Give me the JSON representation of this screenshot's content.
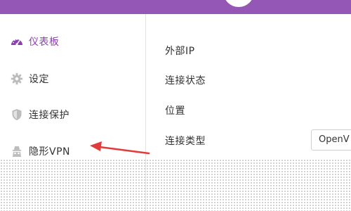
{
  "sidebar": {
    "items": [
      {
        "label": "仪表板",
        "icon": "dashboard-icon",
        "active": true
      },
      {
        "label": "设定",
        "icon": "gear-icon",
        "active": false
      },
      {
        "label": "连接保护",
        "icon": "shield-icon",
        "active": false
      },
      {
        "label": "隐形VPN",
        "icon": "stealth-vpn-icon",
        "active": false
      }
    ]
  },
  "main": {
    "rows": [
      {
        "label": "外部IP"
      },
      {
        "label": "连接状态"
      },
      {
        "label": "位置"
      },
      {
        "label": "连接类型"
      }
    ],
    "connection_type_select": {
      "value": "OpenV"
    }
  },
  "annotation": {
    "arrow_color": "#e23b3b"
  },
  "colors": {
    "header": "#9457b5",
    "active_text": "#8b3fb0",
    "icon_gray": "#bdbdbd"
  }
}
